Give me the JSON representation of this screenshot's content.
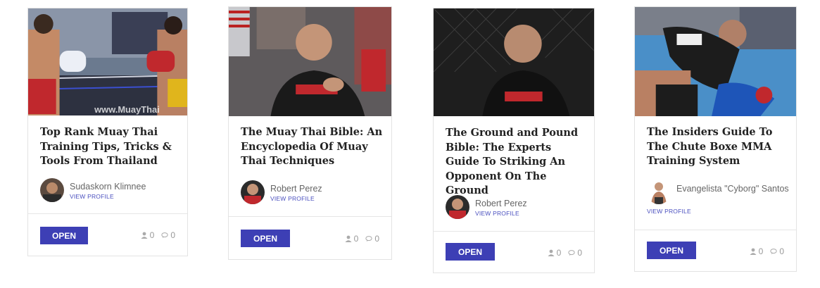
{
  "cards": [
    {
      "title": "Top Rank Muay Thai Training Tips, Tricks & Tools From Thailand",
      "author_name": "Sudaskorn Klimnee",
      "view_profile": "VIEW PROFILE",
      "open_label": "OPEN",
      "likes": "0",
      "comments": "0",
      "watermark": "www.MuayThai"
    },
    {
      "title": "The Muay Thai Bible: An Encyclopedia Of Muay Thai Techniques",
      "author_name": "Robert Perez",
      "view_profile": "VIEW PROFILE",
      "open_label": "OPEN",
      "likes": "0",
      "comments": "0"
    },
    {
      "title": "The Ground and Pound Bible: The Experts Guide To Striking An Opponent On The Ground",
      "author_name": "Robert Perez",
      "view_profile": "VIEW PROFILE",
      "open_label": "OPEN",
      "likes": "0",
      "comments": "0"
    },
    {
      "title": "The Insiders Guide To The Chute Boxe MMA Training System",
      "author_name": "Evangelista \"Cyborg\" Santos",
      "view_profile": "VIEW PROFILE",
      "open_label": "OPEN",
      "likes": "0",
      "comments": "0"
    }
  ],
  "colors": {
    "accent": "#3d3fb5",
    "link": "#4a4fbf",
    "border": "#e3e3e3"
  },
  "icons": {
    "likes": "user-icon",
    "comments": "comment-icon"
  }
}
